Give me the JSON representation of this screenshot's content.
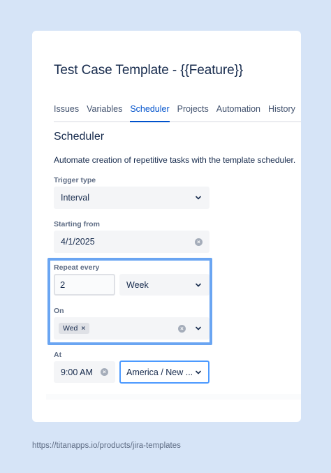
{
  "page": {
    "title": "Test Case Template - {{Feature}}",
    "tabs": [
      {
        "label": "Issues",
        "active": false
      },
      {
        "label": "Variables",
        "active": false
      },
      {
        "label": "Scheduler",
        "active": true
      },
      {
        "label": "Projects",
        "active": false
      },
      {
        "label": "Automation",
        "active": false
      },
      {
        "label": "History",
        "active": false
      }
    ]
  },
  "scheduler": {
    "heading": "Scheduler",
    "description": "Automate creation of repetitive tasks with the template scheduler.",
    "trigger_type": {
      "label": "Trigger type",
      "value": "Interval"
    },
    "starting_from": {
      "label": "Starting from",
      "value": "4/1/2025"
    },
    "repeat_every": {
      "label": "Repeat every",
      "count": "2",
      "unit": "Week"
    },
    "on": {
      "label": "On",
      "tags": [
        "Wed"
      ]
    },
    "at": {
      "label": "At",
      "time": "9:00 AM",
      "timezone": "America / New ..."
    }
  },
  "footer": {
    "url": "https://titanapps.io/products/jira-templates"
  },
  "colors": {
    "accent": "#0052cc",
    "highlight": "#6aa5f2",
    "background": "#d6e4f7"
  }
}
